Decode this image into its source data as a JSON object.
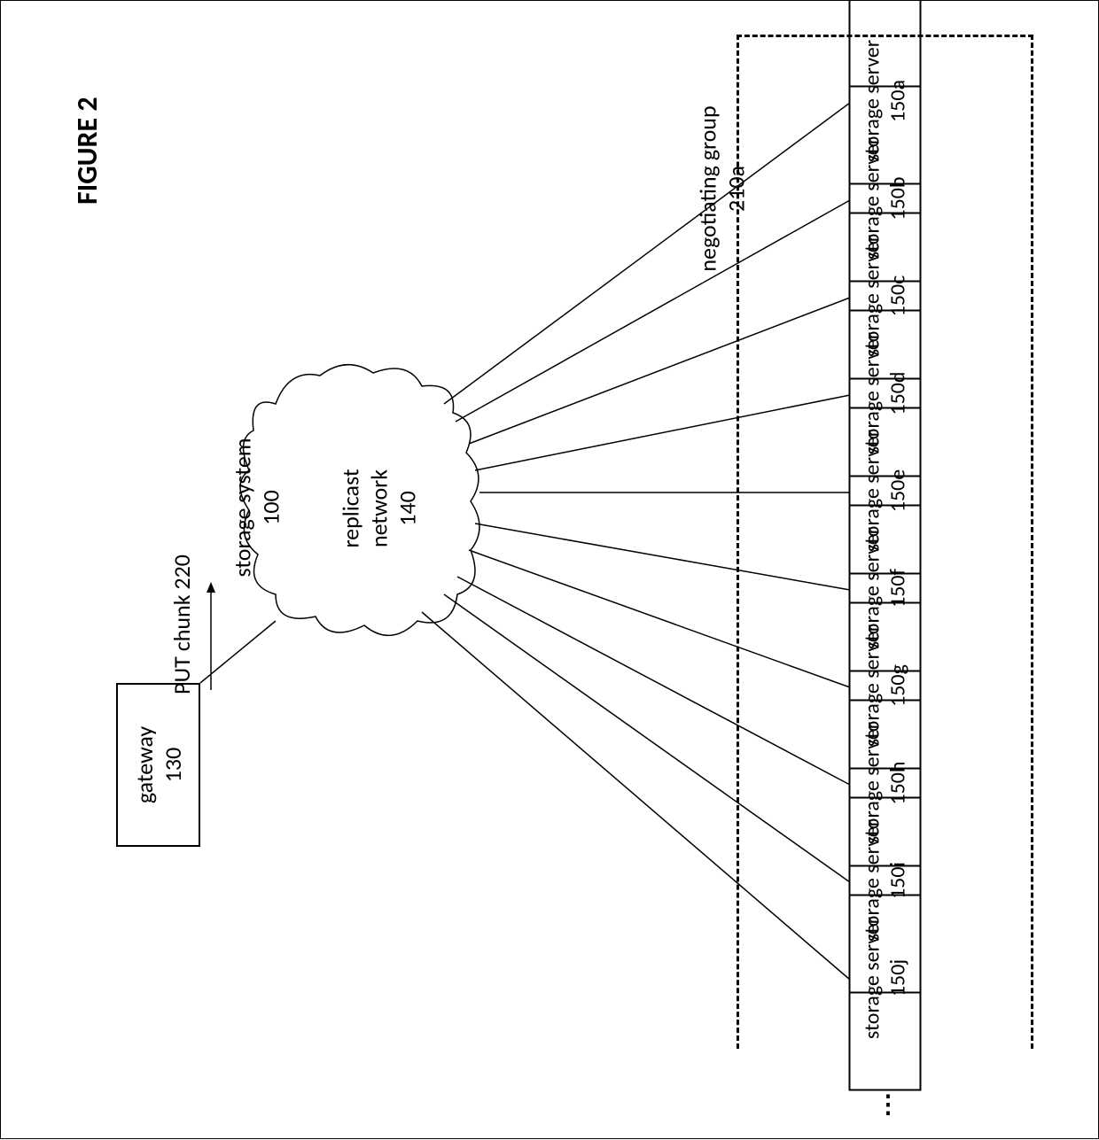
{
  "figure_title": "FIGURE 2",
  "storage_system": "storage system\n100",
  "gateway": "gateway\n130",
  "put_chunk": "PUT chunk 220",
  "cloud_label": "replicast\nnetwork\n140",
  "negotiating_group": "negotiating group\n210a",
  "ellipsis": "⋮",
  "servers": [
    {
      "label": "storage server\n150a"
    },
    {
      "label": "storage server\n150b"
    },
    {
      "label": "storage server\n150c"
    },
    {
      "label": "storage server\n150d"
    },
    {
      "label": "storage server\n150e"
    },
    {
      "label": "storage server\n150f"
    },
    {
      "label": "storage server\n150g"
    },
    {
      "label": "storage server\n150h"
    },
    {
      "label": "storage server\n150i"
    },
    {
      "label": "storage server\n150j"
    }
  ]
}
